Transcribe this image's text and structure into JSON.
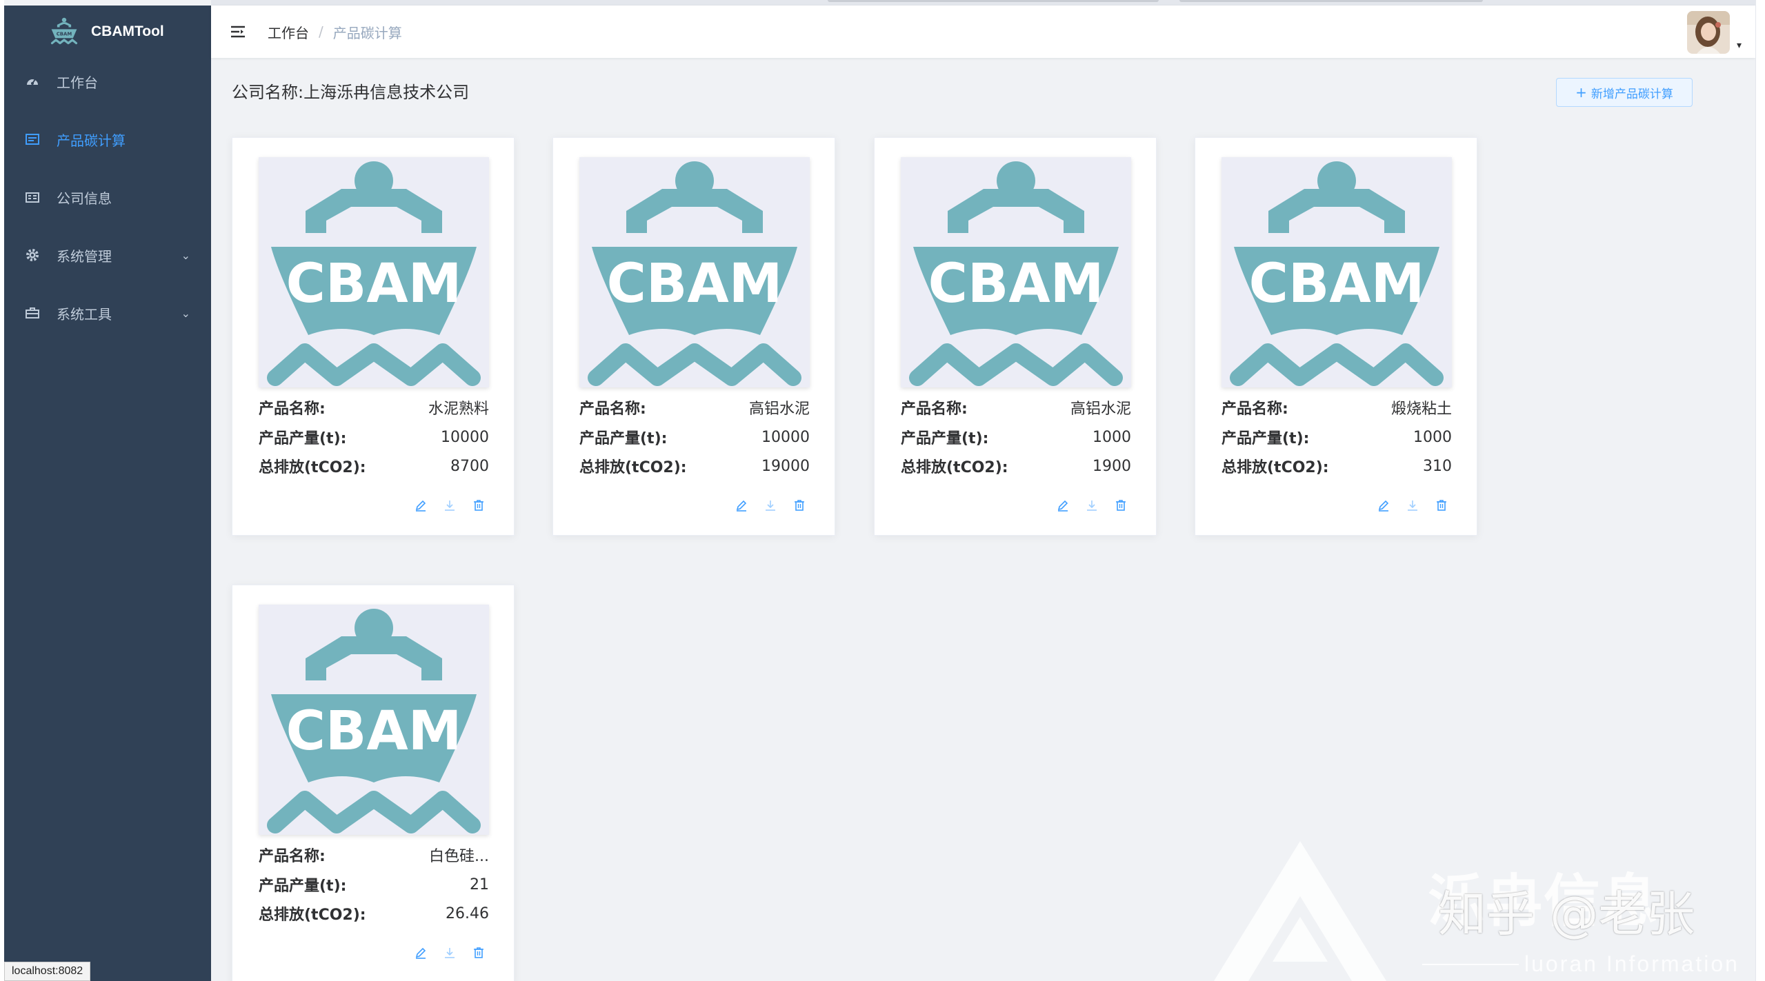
{
  "app": {
    "title": "CBAMTool",
    "status_url": "localhost:8082"
  },
  "sidebar": {
    "items": [
      {
        "label": "工作台",
        "icon": "dashboard-icon",
        "active": false,
        "expandable": false
      },
      {
        "label": "产品碳计算",
        "icon": "document-icon",
        "active": true,
        "expandable": false
      },
      {
        "label": "公司信息",
        "icon": "company-icon",
        "active": false,
        "expandable": false
      },
      {
        "label": "系统管理",
        "icon": "gear-icon",
        "active": false,
        "expandable": true
      },
      {
        "label": "系统工具",
        "icon": "toolbox-icon",
        "active": false,
        "expandable": true
      }
    ]
  },
  "header": {
    "breadcrumb": [
      "工作台",
      "产品碳计算"
    ],
    "breadcrumb_sep": "/"
  },
  "main": {
    "company_label": "公司名称:",
    "company_name": "上海泺冉信息技术公司",
    "add_button": "新增产品碳计算",
    "field_labels": {
      "name": "产品名称:",
      "output": "产品产量(t):",
      "emission": "总排放(tCO2):"
    },
    "logo_text": "CBAM",
    "cards": [
      {
        "name": "水泥熟料",
        "output": "10000",
        "emission": "8700"
      },
      {
        "name": "高铝水泥",
        "output": "10000",
        "emission": "19000"
      },
      {
        "name": "高铝水泥",
        "output": "1000",
        "emission": "1900"
      },
      {
        "name": "煅烧粘土",
        "output": "1000",
        "emission": "310"
      },
      {
        "name": "白色硅...",
        "output": "21",
        "emission": "26.46"
      }
    ]
  },
  "watermark": {
    "brand": "泺冉信息",
    "zhihu": "知乎 @老张",
    "sub": "luoran Information"
  },
  "colors": {
    "sidebar": "#304156",
    "accent": "#409eff",
    "logo_teal": "#73b3bd",
    "logo_bg": "#ecedf6"
  }
}
